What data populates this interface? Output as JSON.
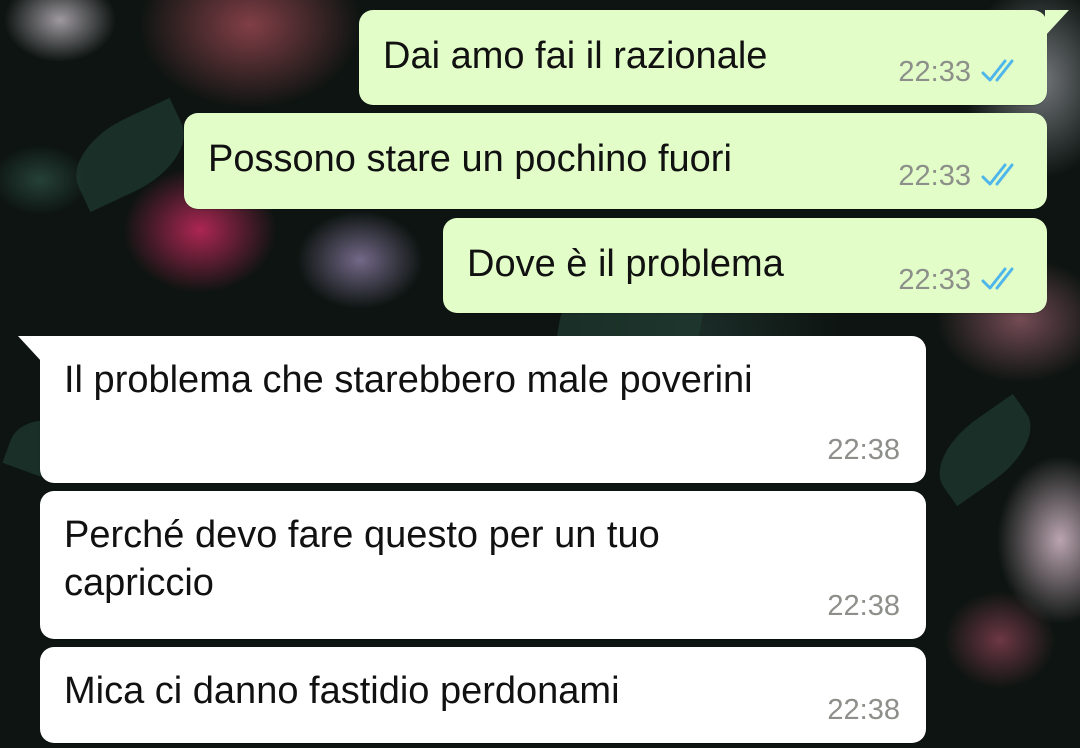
{
  "colors": {
    "outgoing_bubble": "#e2fdc8",
    "incoming_bubble": "#ffffff",
    "read_ticks": "#4fb6ec",
    "timestamp": "#8d8f8a"
  },
  "messages": [
    {
      "direction": "outgoing",
      "text": "Dai amo fai il razionale",
      "time": "22:33",
      "status_icon": "double-check-read-icon"
    },
    {
      "direction": "outgoing",
      "text": "Possono stare un pochino fuori",
      "time": "22:33",
      "status_icon": "double-check-read-icon"
    },
    {
      "direction": "outgoing",
      "text": "Dove è il problema",
      "time": "22:33",
      "status_icon": "double-check-read-icon"
    },
    {
      "direction": "incoming",
      "text": "Il problema che starebbero male poverini",
      "time": "22:38"
    },
    {
      "direction": "incoming",
      "text": "Perché devo fare questo per un tuo\ncapriccio",
      "time": "22:38"
    },
    {
      "direction": "incoming",
      "text": "Mica ci danno fastidio perdonami",
      "time": "22:38"
    }
  ]
}
